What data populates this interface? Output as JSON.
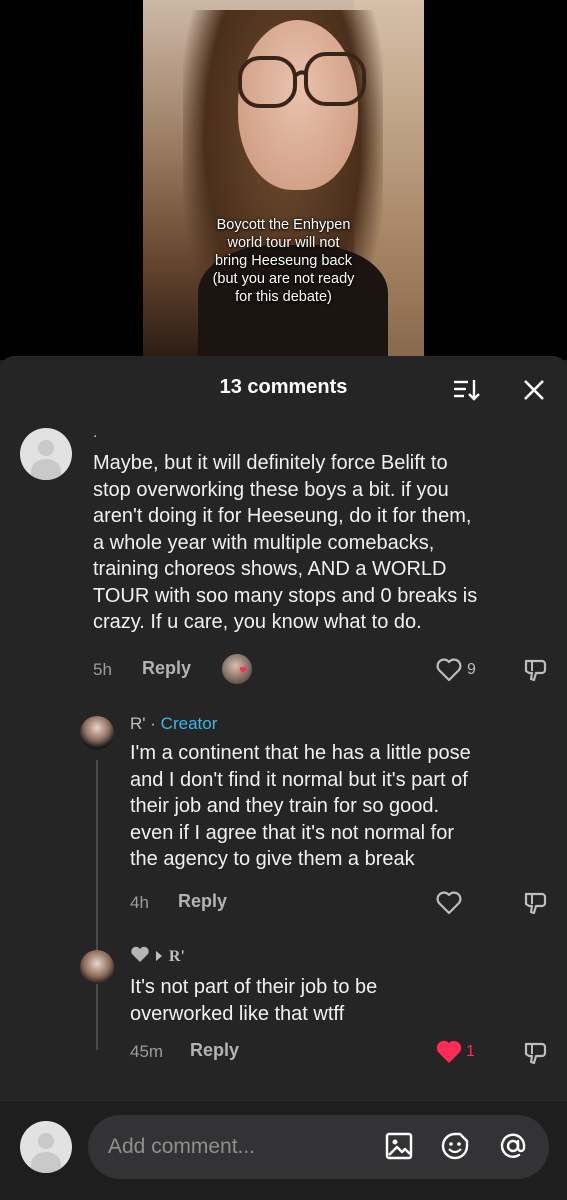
{
  "video": {
    "caption_lines": [
      "Boycott the Enhypen",
      "world tour will not",
      "bring Heeseung back",
      "(but you are not ready",
      "for this debate)"
    ]
  },
  "header": {
    "title": "13 comments",
    "sort_icon": "sort-icon",
    "close_icon": "close-icon"
  },
  "comments": [
    {
      "username": ".",
      "lines": [
        "Maybe, but it will definitely force Belift to",
        "stop overworking these boys a bit. if you",
        "aren't doing it for Heeseung, do it for them,",
        "a whole year with multiple comebacks,",
        "training choreos shows, AND a WORLD",
        "TOUR with soo many stops and 0 breaks is",
        "crazy. If u care, you know what to do."
      ],
      "time": "5h",
      "reply_label": "Reply",
      "likes": "9"
    },
    {
      "username": "R'",
      "separator": "·",
      "badge": "Creator",
      "lines": [
        "I'm a continent that he has a little pose",
        "and I don't find it normal but it's part of",
        "their job and they train for so good.",
        "even if I agree that it's not normal for",
        "the agency to give them a break"
      ],
      "time": "4h",
      "reply_label": "Reply"
    },
    {
      "username": "R'",
      "lines": [
        "It's not part of their job to be",
        "overworked like that wtff"
      ],
      "time": "45m",
      "reply_label": "Reply",
      "likes": "1"
    }
  ],
  "composer": {
    "placeholder": "Add comment..."
  },
  "colors": {
    "accent_blue": "#3bb7e8",
    "like_red": "#fe2c55",
    "sheet_bg": "#252526"
  }
}
